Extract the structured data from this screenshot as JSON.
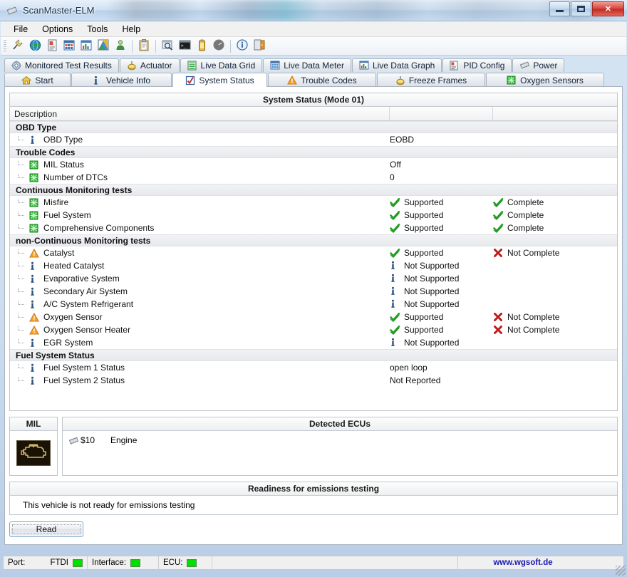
{
  "window": {
    "title": "ScanMaster-ELM",
    "icon": "chip-icon",
    "controls": {
      "minimize": "minimize-icon",
      "maximize": "maximize-icon",
      "close": "✕"
    }
  },
  "menubar": {
    "items": [
      {
        "label": "File"
      },
      {
        "label": "Options"
      },
      {
        "label": "Tools"
      },
      {
        "label": "Help"
      }
    ]
  },
  "toolbar": {
    "buttons": [
      {
        "name": "connect-icon"
      },
      {
        "name": "globe-icon"
      },
      {
        "name": "report-icon"
      },
      {
        "name": "grid-icon"
      },
      {
        "name": "chart-icon"
      },
      {
        "name": "graph-icon"
      },
      {
        "name": "user-icon"
      },
      {
        "name": "separator"
      },
      {
        "name": "clipboard-icon"
      },
      {
        "name": "separator"
      },
      {
        "name": "search-icon"
      },
      {
        "name": "terminal-icon"
      },
      {
        "name": "battery-icon"
      },
      {
        "name": "gauge-icon"
      },
      {
        "name": "separator"
      },
      {
        "name": "info-icon"
      },
      {
        "name": "exit-icon"
      }
    ]
  },
  "tabs_row1": [
    {
      "label": "Monitored Test Results",
      "icon": "gear-icon",
      "active": false
    },
    {
      "label": "Actuator",
      "icon": "actuator-icon",
      "active": false
    },
    {
      "label": "Live Data Grid",
      "icon": "list-icon",
      "active": false
    },
    {
      "label": "Live Data Meter",
      "icon": "meter-icon",
      "active": false
    },
    {
      "label": "Live Data Graph",
      "icon": "bargraph-icon",
      "active": false
    },
    {
      "label": "PID Config",
      "icon": "pidconfig-icon",
      "active": false
    },
    {
      "label": "Power",
      "icon": "power-icon",
      "active": false
    }
  ],
  "tabs_row2": [
    {
      "label": "Start",
      "icon": "home-icon",
      "active": false
    },
    {
      "label": "Vehicle Info",
      "icon": "info-icon",
      "active": false
    },
    {
      "label": "System Status",
      "icon": "checkbox-icon",
      "active": true
    },
    {
      "label": "Trouble Codes",
      "icon": "warning-icon",
      "active": false
    },
    {
      "label": "Freeze Frames",
      "icon": "actuator-icon",
      "active": false
    },
    {
      "label": "Oxygen Sensors",
      "icon": "sensor-icon",
      "active": false
    }
  ],
  "system_status": {
    "panel_title": "System Status (Mode 01)",
    "columns": [
      "Description",
      "",
      ""
    ],
    "groups": [
      {
        "title": "OBD Type",
        "rows": [
          {
            "icon": "info-icon",
            "label": "OBD Type",
            "col2": "EOBD",
            "col2_icon": "none",
            "col3": "",
            "col3_icon": "none"
          }
        ]
      },
      {
        "title": "Trouble Codes",
        "rows": [
          {
            "icon": "sensor-icon",
            "label": "MIL Status",
            "col2": "Off",
            "col2_icon": "none",
            "col3": "",
            "col3_icon": "none"
          },
          {
            "icon": "sensor-icon",
            "label": "Number of DTCs",
            "col2": "0",
            "col2_icon": "none",
            "col3": "",
            "col3_icon": "none"
          }
        ]
      },
      {
        "title": "Continuous Monitoring tests",
        "rows": [
          {
            "icon": "sensor-icon",
            "label": "Misfire",
            "col2": "Supported",
            "col2_icon": "check-icon",
            "col3": "Complete",
            "col3_icon": "check-icon"
          },
          {
            "icon": "sensor-icon",
            "label": "Fuel System",
            "col2": "Supported",
            "col2_icon": "check-icon",
            "col3": "Complete",
            "col3_icon": "check-icon"
          },
          {
            "icon": "sensor-icon",
            "label": "Comprehensive Components",
            "col2": "Supported",
            "col2_icon": "check-icon",
            "col3": "Complete",
            "col3_icon": "check-icon"
          }
        ]
      },
      {
        "title": "non-Continuous Monitoring tests",
        "rows": [
          {
            "icon": "warning-icon",
            "label": "Catalyst",
            "col2": "Supported",
            "col2_icon": "check-icon",
            "col3": "Not Complete",
            "col3_icon": "cross-icon"
          },
          {
            "icon": "info-icon",
            "label": "Heated Catalyst",
            "col2": "Not Supported",
            "col2_icon": "info-icon",
            "col3": "",
            "col3_icon": "none"
          },
          {
            "icon": "info-icon",
            "label": "Evaporative System",
            "col2": "Not Supported",
            "col2_icon": "info-icon",
            "col3": "",
            "col3_icon": "none"
          },
          {
            "icon": "info-icon",
            "label": "Secondary Air System",
            "col2": "Not Supported",
            "col2_icon": "info-icon",
            "col3": "",
            "col3_icon": "none"
          },
          {
            "icon": "info-icon",
            "label": "A/C System Refrigerant",
            "col2": "Not Supported",
            "col2_icon": "info-icon",
            "col3": "",
            "col3_icon": "none"
          },
          {
            "icon": "warning-icon",
            "label": "Oxygen Sensor",
            "col2": "Supported",
            "col2_icon": "check-icon",
            "col3": "Not Complete",
            "col3_icon": "cross-icon"
          },
          {
            "icon": "warning-icon",
            "label": "Oxygen Sensor Heater",
            "col2": "Supported",
            "col2_icon": "check-icon",
            "col3": "Not Complete",
            "col3_icon": "cross-icon"
          },
          {
            "icon": "info-icon",
            "label": "EGR System",
            "col2": "Not Supported",
            "col2_icon": "info-icon",
            "col3": "",
            "col3_icon": "none"
          }
        ]
      },
      {
        "title": "Fuel System Status",
        "rows": [
          {
            "icon": "info-icon",
            "label": "Fuel System 1 Status",
            "col2": "open loop",
            "col2_icon": "none",
            "col3": "",
            "col3_icon": "none"
          },
          {
            "icon": "info-icon",
            "label": "Fuel System 2 Status",
            "col2": "Not Reported",
            "col2_icon": "none",
            "col3": "",
            "col3_icon": "none"
          }
        ]
      }
    ]
  },
  "mil": {
    "title": "MIL",
    "lamp_icon": "engine-lamp-icon",
    "lamp_state": "off"
  },
  "ecus": {
    "title": "Detected ECUs",
    "rows": [
      {
        "icon": "chip-icon",
        "address": "$10",
        "name": "Engine"
      }
    ]
  },
  "readiness": {
    "title": "Readiness for emissions testing",
    "message": "This vehicle is not ready for emissions testing"
  },
  "actions": {
    "read_label": "Read"
  },
  "statusbar": {
    "port_label": "Port:",
    "port_value": "FTDI",
    "port_led": "#00e000",
    "interface_label": "Interface:",
    "interface_led": "#00e000",
    "ecu_label": "ECU:",
    "ecu_led": "#00e000",
    "url": "www.wgsoft.de"
  },
  "colors": {
    "accent_link": "#1a1ab0",
    "led_green": "#00e000",
    "check_green": "#2aa32a",
    "cross_red": "#c00000",
    "warn_orange": "#e8821e"
  }
}
